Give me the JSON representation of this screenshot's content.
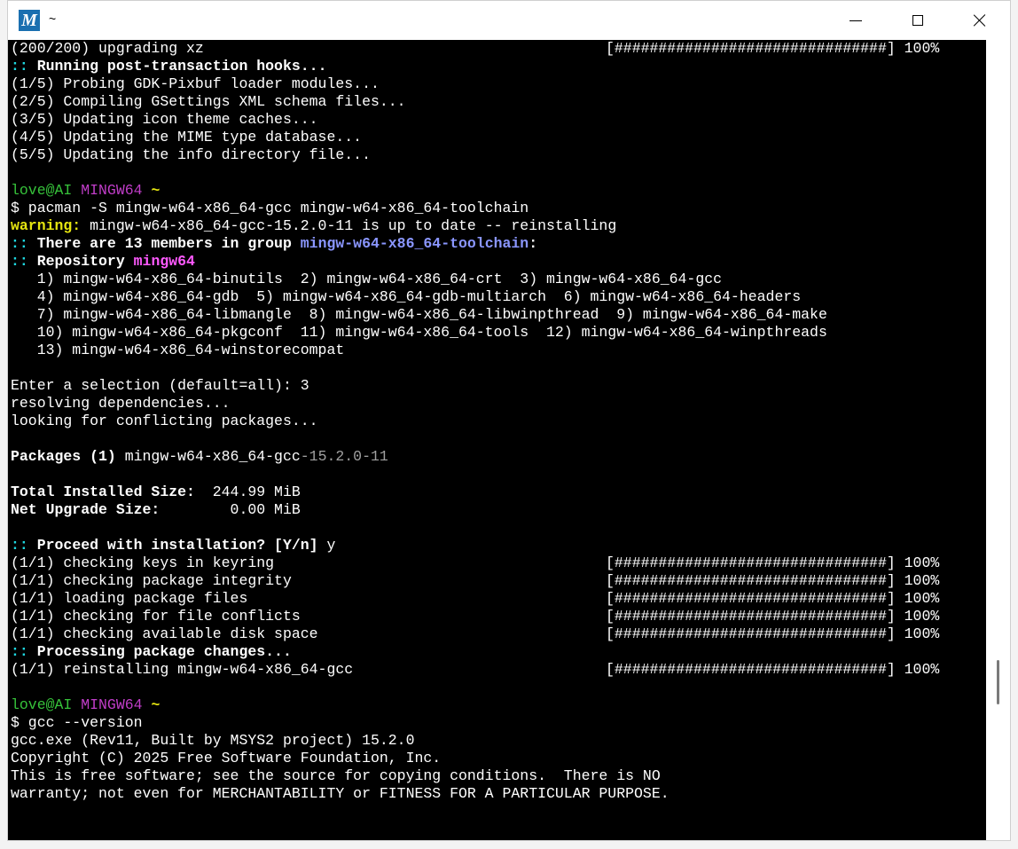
{
  "window": {
    "title": "~",
    "icon": "msys2-logo-icon",
    "icon_letter": "M",
    "accent": "#1a6fb0",
    "controls": [
      "minimize-icon",
      "maximize-icon",
      "close-icon"
    ]
  },
  "terminal": {
    "background": "#000000",
    "lines": [
      {
        "segments": [
          {
            "t": "(200/200) upgrading xz"
          }
        ],
        "progress": "[###############################] 100%"
      },
      {
        "segments": [
          {
            "t": "::",
            "c": "cyan bold"
          },
          {
            "t": " Running post-transaction hooks...",
            "c": "bold"
          }
        ]
      },
      {
        "segments": [
          {
            "t": "(1/5) Probing GDK-Pixbuf loader modules..."
          }
        ]
      },
      {
        "segments": [
          {
            "t": "(2/5) Compiling GSettings XML schema files..."
          }
        ]
      },
      {
        "segments": [
          {
            "t": "(3/5) Updating icon theme caches..."
          }
        ]
      },
      {
        "segments": [
          {
            "t": "(4/5) Updating the MIME type database..."
          }
        ]
      },
      {
        "segments": [
          {
            "t": "(5/5) Updating the info directory file..."
          }
        ]
      },
      {
        "segments": [
          {
            "t": ""
          }
        ]
      },
      {
        "segments": [
          {
            "t": "love@AI",
            "c": "green"
          },
          {
            "t": " "
          },
          {
            "t": "MINGW64",
            "c": "magenta"
          },
          {
            "t": " "
          },
          {
            "t": "~",
            "c": "yellow"
          }
        ]
      },
      {
        "segments": [
          {
            "t": "$ pacman -S mingw-w64-x86_64-gcc mingw-w64-x86_64-toolchain"
          }
        ]
      },
      {
        "segments": [
          {
            "t": "warning:",
            "c": "yellow"
          },
          {
            "t": " mingw-w64-x86_64-gcc-15.2.0-11 is up to date -- reinstalling"
          }
        ]
      },
      {
        "segments": [
          {
            "t": "::",
            "c": "cyan bold"
          },
          {
            "t": " There are 13 members in group ",
            "c": "bold"
          },
          {
            "t": "mingw-w64-x86_64-toolchain",
            "c": "blue"
          },
          {
            "t": ":",
            "c": "bold"
          }
        ]
      },
      {
        "segments": [
          {
            "t": "::",
            "c": "cyan bold"
          },
          {
            "t": " Repository ",
            "c": "bold"
          },
          {
            "t": "mingw64",
            "c": "pink"
          }
        ]
      },
      {
        "segments": [
          {
            "t": "   1) mingw-w64-x86_64-binutils  2) mingw-w64-x86_64-crt  3) mingw-w64-x86_64-gcc"
          }
        ]
      },
      {
        "segments": [
          {
            "t": "   4) mingw-w64-x86_64-gdb  5) mingw-w64-x86_64-gdb-multiarch  6) mingw-w64-x86_64-headers"
          }
        ]
      },
      {
        "segments": [
          {
            "t": "   7) mingw-w64-x86_64-libmangle  8) mingw-w64-x86_64-libwinpthread  9) mingw-w64-x86_64-make"
          }
        ]
      },
      {
        "segments": [
          {
            "t": "   10) mingw-w64-x86_64-pkgconf  11) mingw-w64-x86_64-tools  12) mingw-w64-x86_64-winpthreads"
          }
        ]
      },
      {
        "segments": [
          {
            "t": "   13) mingw-w64-x86_64-winstorecompat"
          }
        ]
      },
      {
        "segments": [
          {
            "t": ""
          }
        ]
      },
      {
        "segments": [
          {
            "t": "Enter a selection (default=all): 3"
          }
        ]
      },
      {
        "segments": [
          {
            "t": "resolving dependencies..."
          }
        ]
      },
      {
        "segments": [
          {
            "t": "looking for conflicting packages..."
          }
        ]
      },
      {
        "segments": [
          {
            "t": ""
          }
        ]
      },
      {
        "segments": [
          {
            "t": "Packages (1)",
            "c": "bold"
          },
          {
            "t": " mingw-w64-x86_64-gcc"
          },
          {
            "t": "-15.2.0-11",
            "c": "gray"
          }
        ]
      },
      {
        "segments": [
          {
            "t": ""
          }
        ]
      },
      {
        "segments": [
          {
            "t": "Total Installed Size:",
            "c": "bold"
          },
          {
            "t": "  244.99 MiB"
          }
        ]
      },
      {
        "segments": [
          {
            "t": "Net Upgrade Size:",
            "c": "bold"
          },
          {
            "t": "        0.00 MiB"
          }
        ]
      },
      {
        "segments": [
          {
            "t": ""
          }
        ]
      },
      {
        "segments": [
          {
            "t": "::",
            "c": "cyan bold"
          },
          {
            "t": " Proceed with installation? [Y/n]",
            "c": "bold"
          },
          {
            "t": " y"
          }
        ]
      },
      {
        "segments": [
          {
            "t": "(1/1) checking keys in keyring"
          }
        ],
        "progress": "[###############################] 100%"
      },
      {
        "segments": [
          {
            "t": "(1/1) checking package integrity"
          }
        ],
        "progress": "[###############################] 100%"
      },
      {
        "segments": [
          {
            "t": "(1/1) loading package files"
          }
        ],
        "progress": "[###############################] 100%"
      },
      {
        "segments": [
          {
            "t": "(1/1) checking for file conflicts"
          }
        ],
        "progress": "[###############################] 100%"
      },
      {
        "segments": [
          {
            "t": "(1/1) checking available disk space"
          }
        ],
        "progress": "[###############################] 100%"
      },
      {
        "segments": [
          {
            "t": "::",
            "c": "cyan bold"
          },
          {
            "t": " Processing package changes...",
            "c": "bold"
          }
        ]
      },
      {
        "segments": [
          {
            "t": "(1/1) reinstalling mingw-w64-x86_64-gcc"
          }
        ],
        "progress": "[###############################] 100%"
      },
      {
        "segments": [
          {
            "t": ""
          }
        ]
      },
      {
        "segments": [
          {
            "t": "love@AI",
            "c": "green"
          },
          {
            "t": " "
          },
          {
            "t": "MINGW64",
            "c": "magenta"
          },
          {
            "t": " "
          },
          {
            "t": "~",
            "c": "yellow"
          }
        ]
      },
      {
        "segments": [
          {
            "t": "$ gcc --version"
          }
        ]
      },
      {
        "segments": [
          {
            "t": "gcc.exe (Rev11, Built by MSYS2 project) 15.2.0"
          }
        ]
      },
      {
        "segments": [
          {
            "t": "Copyright (C) 2025 Free Software Foundation, Inc."
          }
        ]
      },
      {
        "segments": [
          {
            "t": "This is free software; see the source for copying conditions.  There is NO"
          }
        ]
      },
      {
        "segments": [
          {
            "t": "warranty; not even for MERCHANTABILITY or FITNESS FOR A PARTICULAR PURPOSE."
          }
        ]
      }
    ]
  },
  "scrollbar": {
    "position": 0.82
  }
}
